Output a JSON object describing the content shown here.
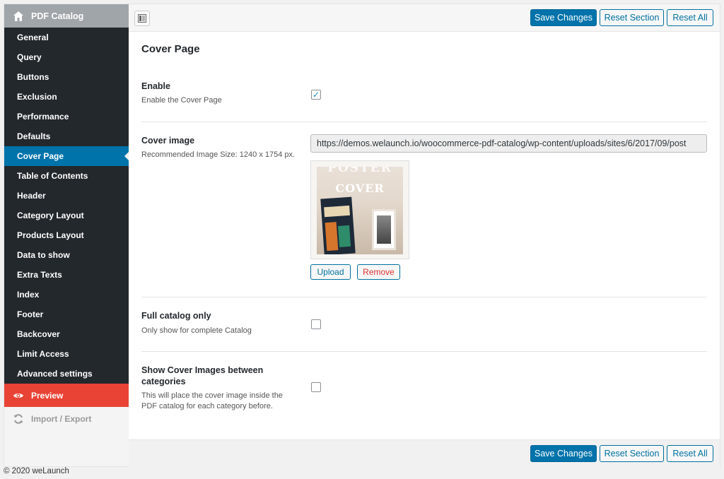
{
  "sidebar": {
    "title": "PDF Catalog",
    "items": [
      {
        "label": "General"
      },
      {
        "label": "Query"
      },
      {
        "label": "Buttons"
      },
      {
        "label": "Exclusion"
      },
      {
        "label": "Performance"
      },
      {
        "label": "Defaults"
      },
      {
        "label": "Cover Page",
        "active": true
      },
      {
        "label": "Table of Contents"
      },
      {
        "label": "Header"
      },
      {
        "label": "Category Layout"
      },
      {
        "label": "Products Layout"
      },
      {
        "label": "Data to show"
      },
      {
        "label": "Extra Texts"
      },
      {
        "label": "Index"
      },
      {
        "label": "Footer"
      },
      {
        "label": "Backcover"
      },
      {
        "label": "Limit Access"
      },
      {
        "label": "Advanced settings"
      }
    ],
    "preview": "Preview",
    "import_export": "Import / Export"
  },
  "toolbar": {
    "save": "Save Changes",
    "reset_section": "Reset Section",
    "reset_all": "Reset All"
  },
  "page": {
    "title": "Cover Page",
    "fields": {
      "enable": {
        "label": "Enable",
        "desc": "Enable the Cover Page",
        "checked": true
      },
      "cover_image": {
        "label": "Cover image",
        "desc": "Recommended Image Size: 1240 x 1754 px.",
        "url": "https://demos.welaunch.io/woocommerce-pdf-catalog/wp-content/uploads/sites/6/2017/09/post",
        "thumb_top": "POSTER",
        "thumb_main": "COVER",
        "upload": "Upload",
        "remove": "Remove"
      },
      "full_catalog": {
        "label": "Full catalog only",
        "desc": "Only show for complete Catalog",
        "checked": false
      },
      "show_between": {
        "label_1": "Show Cover Images between",
        "label_2": "categories",
        "desc_1": "This will place the cover image inside the",
        "desc_2": "PDF catalog for each category before.",
        "checked": false
      }
    }
  },
  "footer": "© 2020 weLaunch",
  "colors": {
    "accent": "#0073aa",
    "preview": "#e84335",
    "sidebar": "#23282d"
  }
}
